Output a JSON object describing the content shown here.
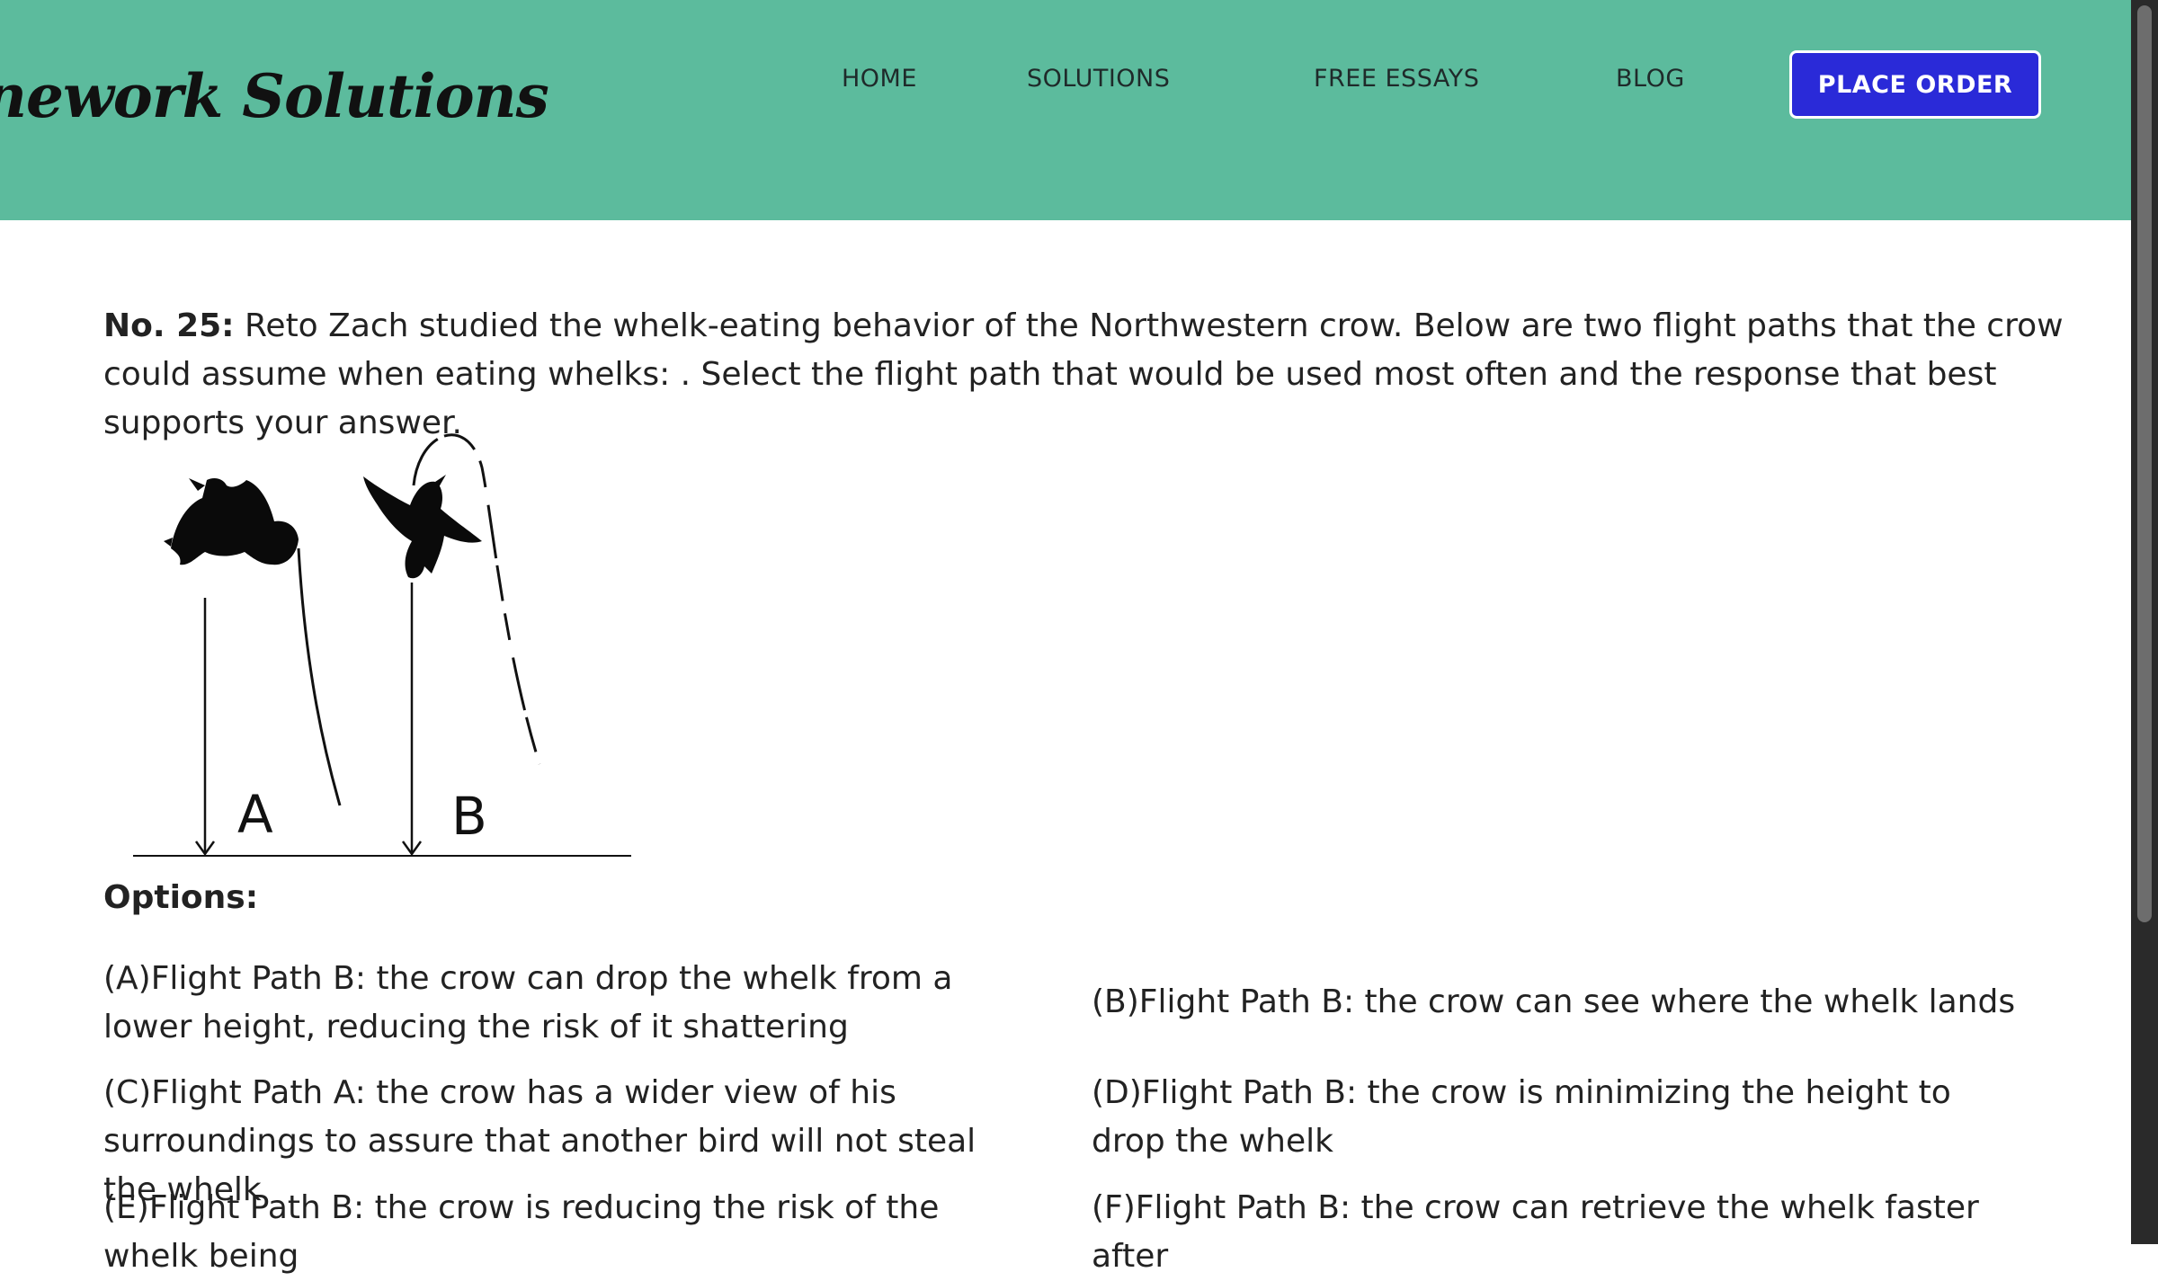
{
  "header": {
    "logo_text": "nework Solutions",
    "nav": {
      "home": "HOME",
      "solutions": "SOLUTIONS",
      "free_essays": "FREE ESSAYS",
      "blog": "BLOG"
    },
    "place_order": "PLACE ORDER"
  },
  "question": {
    "number": "No. 25:",
    "text": " Reto Zach studied the whelk-eating behavior of the Northwestern crow. Below are two flight paths that the crow could assume when eating whelks: . Select the flight path that would be used most often and the response that best supports your answer."
  },
  "figure": {
    "label_a": "A",
    "label_b": "B"
  },
  "options_heading": "Options:",
  "options": {
    "a": "(A)Flight Path B: the crow can drop the whelk from a lower height, reducing the risk of it shattering",
    "b": "(B)Flight Path B: the crow can see where the whelk lands",
    "c": "(C)Flight Path A: the crow has a wider view of his surroundings to assure that another bird will not steal the whelk",
    "d": "(D)Flight Path B: the crow is minimizing the height to drop the whelk",
    "e": "(E)Flight Path B: the crow is reducing the risk of the whelk being",
    "f": "(F)Flight Path B: the crow can retrieve the whelk faster after"
  },
  "colors": {
    "header_bg": "#5cbb9d",
    "button_bg": "#2a2ad8",
    "text": "#222222"
  }
}
